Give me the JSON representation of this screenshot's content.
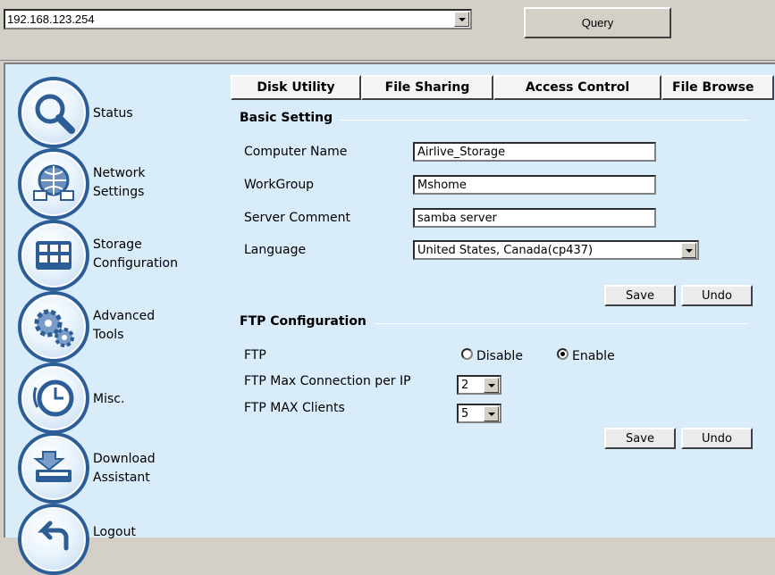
{
  "address_bar": {
    "value": "192.168.123.254"
  },
  "query_button": {
    "label": "Query"
  },
  "sidebar": {
    "items": [
      {
        "label_lines": [
          "Status"
        ],
        "icon": "magnifier-icon"
      },
      {
        "label_lines": [
          "Network",
          "Settings"
        ],
        "icon": "network-icon"
      },
      {
        "label_lines": [
          "Storage",
          "Configuration"
        ],
        "icon": "storage-grid-icon"
      },
      {
        "label_lines": [
          "Advanced",
          "Tools"
        ],
        "icon": "gears-icon"
      },
      {
        "label_lines": [
          "Misc."
        ],
        "icon": "clock-icon"
      },
      {
        "label_lines": [
          "Download",
          "Assistant"
        ],
        "icon": "download-icon"
      },
      {
        "label_lines": [
          "Logout"
        ],
        "icon": "logout-arrow-icon"
      }
    ]
  },
  "tabs": [
    {
      "label": "Disk Utility"
    },
    {
      "label": "File Sharing"
    },
    {
      "label": "Access Control"
    },
    {
      "label": "File Browse"
    }
  ],
  "basic_setting": {
    "title": "Basic Setting",
    "computer_name": {
      "label": "Computer Name",
      "value": "Airlive_Storage"
    },
    "workgroup": {
      "label": "WorkGroup",
      "value": "Mshome"
    },
    "server_comment": {
      "label": "Server Comment",
      "value": "samba server"
    },
    "language": {
      "label": "Language",
      "value": "United States, Canada(cp437)"
    },
    "save_label": "Save",
    "undo_label": "Undo"
  },
  "ftp_configuration": {
    "title": "FTP Configuration",
    "ftp": {
      "label": "FTP",
      "disable_label": "Disable",
      "enable_label": "Enable",
      "selected": "Enable"
    },
    "max_connection_per_ip": {
      "label": "FTP Max Connection per IP",
      "value": "2"
    },
    "max_clients": {
      "label": "FTP MAX Clients",
      "value": "5"
    },
    "save_label": "Save",
    "undo_label": "Undo"
  },
  "colors": {
    "content_background": "#d9ecfa",
    "icon_ring": "#2c5d97",
    "window_chrome": "#d4d0c8"
  }
}
